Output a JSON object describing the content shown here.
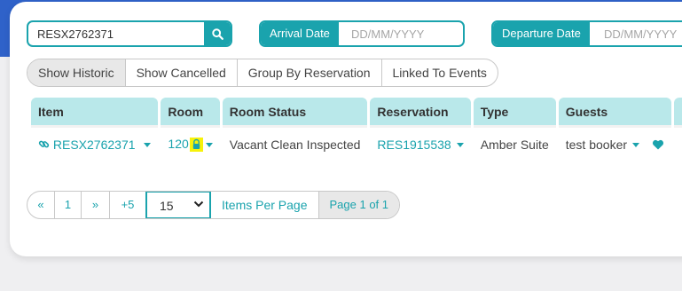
{
  "search": {
    "value": "RESX2762371"
  },
  "arrival": {
    "label": "Arrival Date",
    "placeholder": "DD/MM/YYYY"
  },
  "departure": {
    "label": "Departure Date",
    "placeholder": "DD/MM/YYYY"
  },
  "filters": [
    "Show Historic",
    "Show Cancelled",
    "Group By Reservation",
    "Linked To Events"
  ],
  "table": {
    "headers": [
      "Item",
      "Room",
      "Room Status",
      "Reservation",
      "Type",
      "Guests"
    ],
    "row": {
      "item": "RESX2762371",
      "room": "120",
      "room_status": "Vacant Clean Inspected",
      "reservation": "RES1915538",
      "type": "Amber Suite",
      "guests": "test booker"
    }
  },
  "pagination": {
    "first": "«",
    "page": "1",
    "next": "»",
    "plus5": "+5",
    "per_page": "15",
    "per_page_label": "Items Per Page",
    "status": "Page 1 of 1"
  },
  "colors": {
    "accent": "#1aa3ad",
    "header_bg": "#b9e8ea",
    "highlight": "#f7f20a",
    "band": "#2f62c9"
  }
}
